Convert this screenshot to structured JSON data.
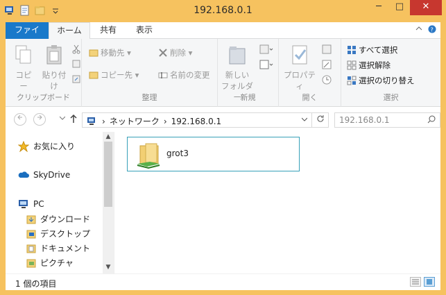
{
  "window": {
    "title": "192.168.0.1",
    "controls": {
      "minimize": "─",
      "maximize": "□",
      "close": "✕"
    }
  },
  "tabs": [
    {
      "label": "ファイル",
      "active": false
    },
    {
      "label": "ホーム",
      "active": true
    },
    {
      "label": "共有",
      "active": false
    },
    {
      "label": "表示",
      "active": false
    }
  ],
  "ribbon": {
    "clipboard": {
      "label": "クリップボード",
      "copy": "コピー",
      "paste": "貼り付け"
    },
    "organize": {
      "label": "整理",
      "move_to": "移動先",
      "copy_to": "コピー先",
      "delete": "削除",
      "rename": "名前の変更"
    },
    "new": {
      "label": "新規",
      "new_folder_line1": "新しい",
      "new_folder_line2": "フォルダー"
    },
    "open": {
      "label": "開く",
      "properties": "プロパティ"
    },
    "select": {
      "label": "選択",
      "select_all": "すべて選択",
      "select_none": "選択解除",
      "invert": "選択の切り替え"
    }
  },
  "address": {
    "crumbs": [
      "ネットワーク",
      "192.168.0.1"
    ],
    "search_placeholder": "192.168.0.1"
  },
  "nav": {
    "favorites": "お気に入り",
    "skydrive": "SkyDrive",
    "pc": "PC",
    "children": [
      "ダウンロード",
      "デスクトップ",
      "ドキュメント",
      "ピクチャ"
    ]
  },
  "content": {
    "items": [
      {
        "name": "grot3",
        "icon": "shared-folder-icon"
      }
    ]
  },
  "status": {
    "count": "1 個の項目"
  },
  "colors": {
    "title_bar": "#f6c25f",
    "file_tab": "#1979ca",
    "close_button": "#c7372f",
    "selection_border": "#36a0b8"
  }
}
